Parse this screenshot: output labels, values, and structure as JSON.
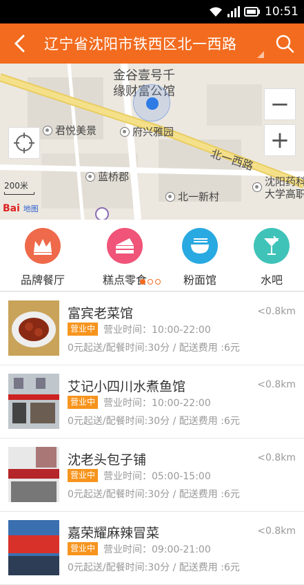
{
  "status_bar": {
    "time": "10:51"
  },
  "header": {
    "title": "辽宁省沈阳市铁西区北一西路"
  },
  "map": {
    "building_label_line1": "金谷壹号千",
    "building_label_line2": "缘财富公馆",
    "pois": [
      "君悦美景",
      "府兴雅园",
      "蓝桥郡",
      "北一新村",
      "沈阳药科",
      "大学高职"
    ],
    "road_label": "北一西路",
    "scale": "200米",
    "logo_text": "Bai",
    "logo_sub": "地图",
    "zoom_out": "−",
    "zoom_in": "+"
  },
  "categories": [
    {
      "label": "品牌餐厅",
      "icon": "crown-icon",
      "color": "#ee6a4a"
    },
    {
      "label": "糕点零食",
      "icon": "cake-icon",
      "color": "#f05478"
    },
    {
      "label": "粉面馆",
      "icon": "noodle-bowl-icon",
      "color": "#29a9e1"
    },
    {
      "label": "水吧",
      "icon": "cocktail-icon",
      "color": "#3fc3b9"
    }
  ],
  "restaurants": [
    {
      "name": "富宾老菜馆",
      "distance": "<0.8km",
      "status": "营业中",
      "hours": "营业时间：10:00-22:00",
      "delivery": "0元起送/配餐时间:30分 / 配送费用 :6元"
    },
    {
      "name": "艾记小四川水煮鱼馆",
      "distance": "<0.8km",
      "status": "营业中",
      "hours": "营业时间：10:00-22:00",
      "delivery": "0元起送/配餐时间:30分 / 配送费用 :6元"
    },
    {
      "name": "沈老头包子铺",
      "distance": "<0.8km",
      "status": "营业中",
      "hours": "营业时间：05:00-15:00",
      "delivery": "0元起送/配餐时间:30分 / 配送费用 :6元"
    },
    {
      "name": "嘉荣耀麻辣冒菜",
      "distance": "<0.8km",
      "status": "营业中",
      "hours": "营业时间：09:00-21:00",
      "delivery": "0元起送/配餐时间:30分 / 配送费用 :6元"
    }
  ]
}
